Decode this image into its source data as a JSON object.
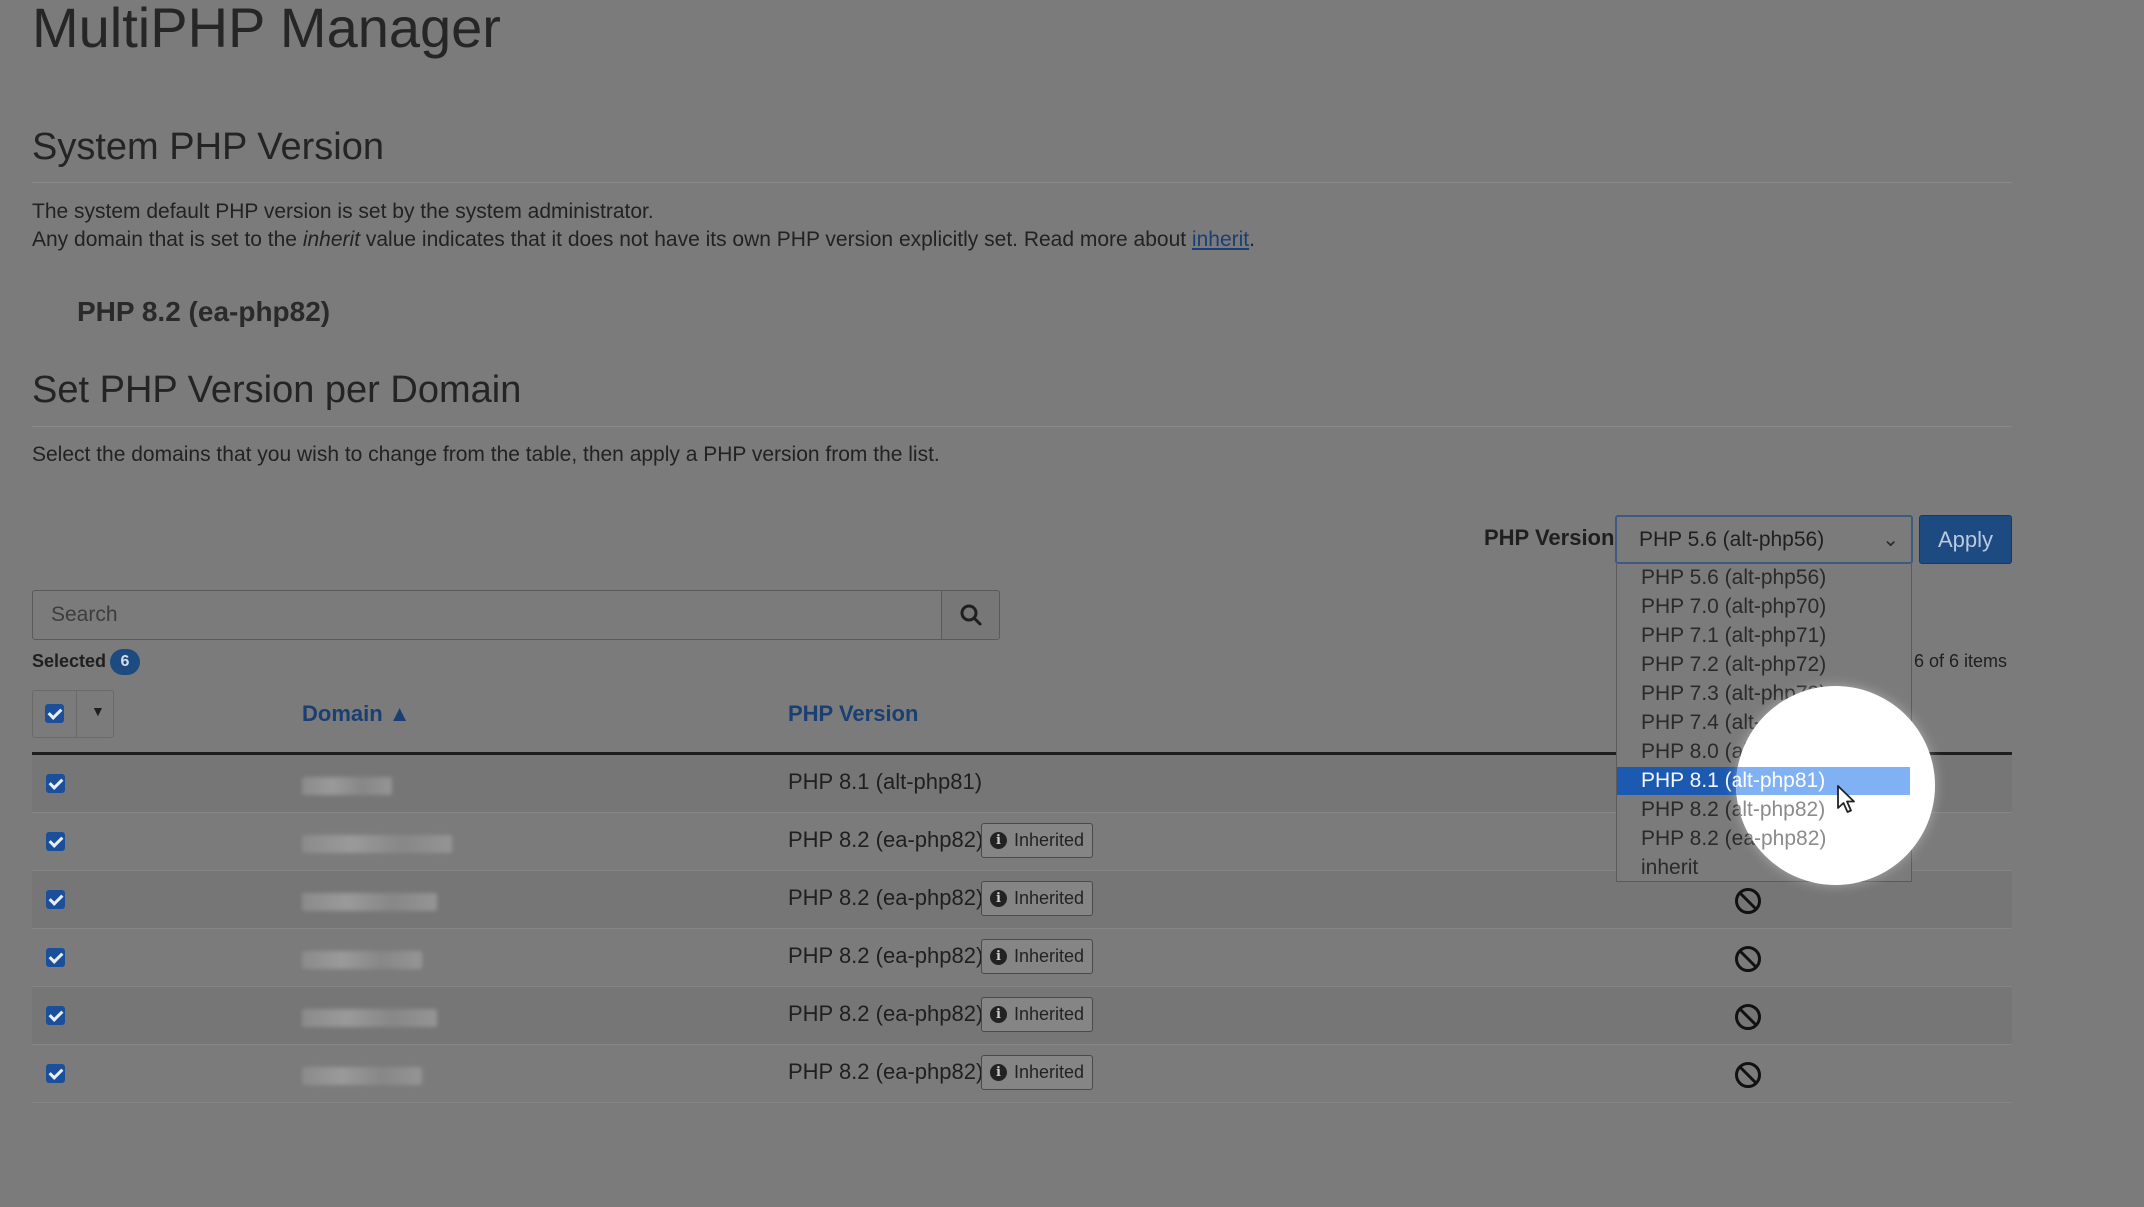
{
  "page": {
    "title": "MultiPHP Manager"
  },
  "system": {
    "heading": "System PHP Version",
    "desc_line1": "The system default PHP version is set by the system administrator.",
    "desc_line2_pre": "Any domain that is set to the ",
    "desc_line2_em": "inherit",
    "desc_line2_mid": " value indicates that it does not have its own PHP version explicitly set. Read more about ",
    "desc_line2_link": "inherit",
    "desc_line2_post": ".",
    "current_version": "PHP 8.2 (ea-php82)"
  },
  "per_domain": {
    "heading": "Set PHP Version per Domain",
    "desc": "Select the domains that you wish to change from the table, then apply a PHP version from the list.",
    "version_label": "PHP Version",
    "selected_value": "PHP 5.6 (alt-php56)",
    "apply_label": "Apply",
    "search_placeholder": "Search",
    "selected_label": "Selected",
    "selected_count": "6",
    "items_count": "6 of 6 items"
  },
  "table": {
    "columns": [
      "Domain ▲",
      "PHP Version"
    ],
    "rows": [
      {
        "domain": "",
        "php": "PHP 8.1 (alt-php81)",
        "inherited": false
      },
      {
        "domain": "",
        "php": "PHP 8.2 (ea-php82)",
        "inherited": true
      },
      {
        "domain": "",
        "php": "PHP 8.2 (ea-php82)",
        "inherited": true
      },
      {
        "domain": "",
        "php": "PHP 8.2 (ea-php82)",
        "inherited": true
      },
      {
        "domain": "",
        "php": "PHP 8.2 (ea-php82)",
        "inherited": true
      },
      {
        "domain": "",
        "php": "PHP 8.2 (ea-php82)",
        "inherited": true
      }
    ],
    "inherited_label": "Inherited"
  },
  "dropdown": {
    "options": [
      "PHP 5.6 (alt-php56)",
      "PHP 7.0 (alt-php70)",
      "PHP 7.1 (alt-php71)",
      "PHP 7.2 (alt-php72)",
      "PHP 7.3 (alt-php73)",
      "PHP 7.4 (alt-php74)",
      "PHP 8.0 (alt-php80)",
      "PHP 8.1 (alt-php81)",
      "PHP 8.2 (alt-php82)",
      "PHP 8.2 (ea-php82)",
      "inherit"
    ],
    "highlighted_index": 7
  },
  "icons": {
    "search": "search-icon",
    "ban": "ban-icon",
    "info": "info-icon",
    "caret": "caret-down-icon",
    "cursor": "mouse-pointer-icon"
  },
  "colors": {
    "accent": "#1d4a80",
    "highlight": "#1c5ab1",
    "link": "#1b3f74"
  }
}
